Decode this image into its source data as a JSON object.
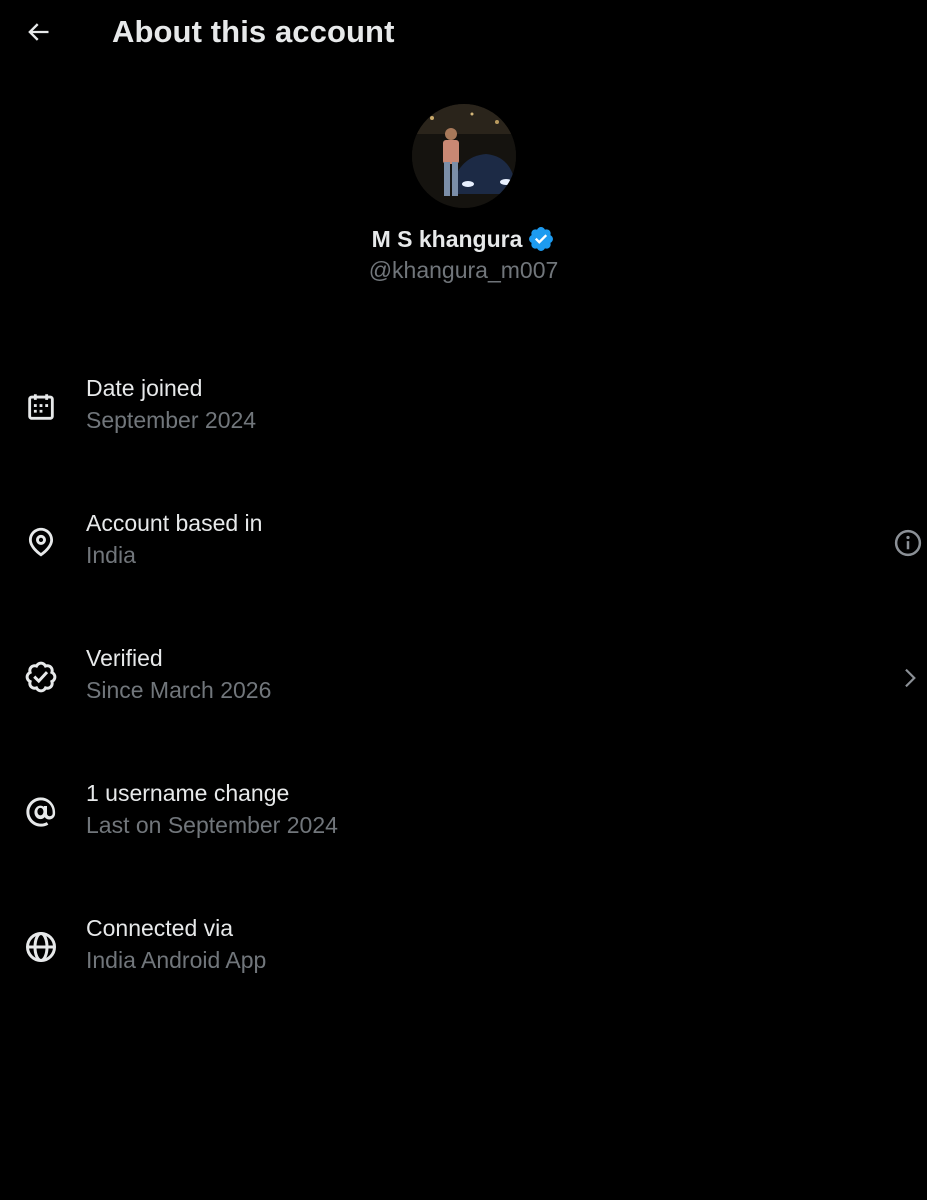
{
  "header": {
    "back_icon": "arrow-left-icon",
    "title": "About this account"
  },
  "profile": {
    "avatar_alt": "profile photo",
    "name": "M S khangura",
    "verified_icon": "verified-badge-icon",
    "verified_color": "#1d9bf0",
    "handle": "@khangura_m007"
  },
  "rows": [
    {
      "icon": "calendar-icon",
      "title": "Date joined",
      "subtitle": "September 2024"
    },
    {
      "icon": "location-pin-icon",
      "title": "Account based in",
      "subtitle": "India",
      "trailing_icon": "info-icon"
    },
    {
      "icon": "verified-outline-icon",
      "title": "Verified",
      "subtitle": "Since March 2026",
      "trailing_icon": "chevron-right-icon"
    },
    {
      "icon": "at-sign-icon",
      "title": "1 username change",
      "subtitle": "Last on September 2024"
    },
    {
      "icon": "globe-icon",
      "title": "Connected via",
      "subtitle": "India Android App"
    }
  ],
  "colors": {
    "background": "#000000",
    "primary_text": "#e7e9ea",
    "secondary_text": "#71767b",
    "accent": "#1d9bf0"
  }
}
